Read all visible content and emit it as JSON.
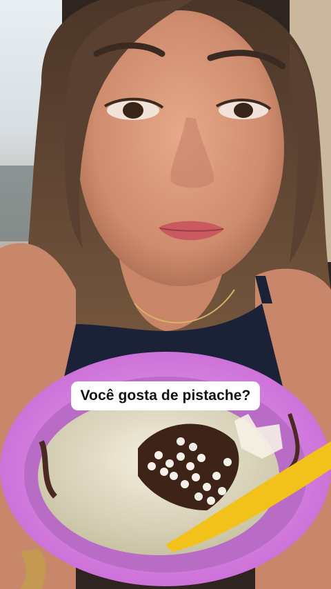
{
  "caption": {
    "text": "Você gosta de pistache?"
  },
  "colors": {
    "caption_bg": "#ffffff",
    "caption_text": "#111111",
    "cup": "#d77fe0",
    "spoon": "#f2c21a"
  }
}
